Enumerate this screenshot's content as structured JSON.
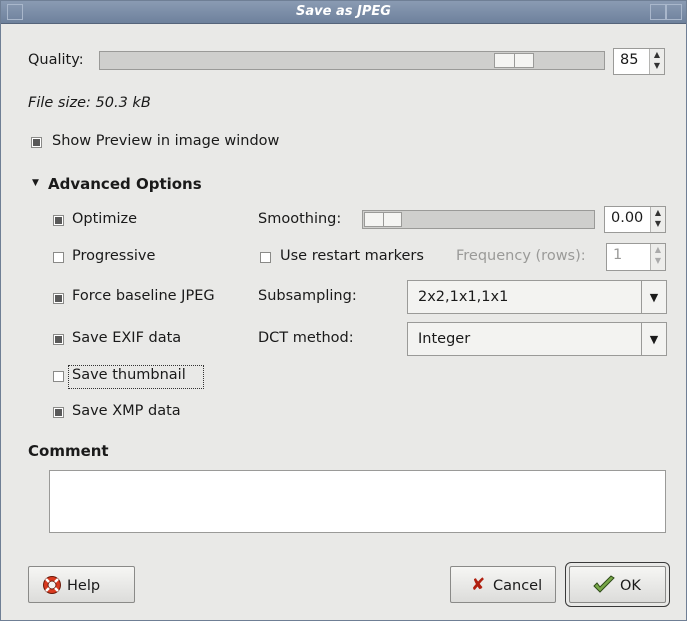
{
  "window": {
    "title": "Save as JPEG"
  },
  "quality": {
    "label": "Quality:",
    "value": "85",
    "fraction": 0.85
  },
  "file_size": {
    "text": "File size: 50.3 kB"
  },
  "show_preview": {
    "label": "Show Preview in image window",
    "checked": true
  },
  "advanced": {
    "header": "Advanced Options",
    "expanded": true,
    "checkboxes": [
      {
        "label": "Optimize",
        "checked": true
      },
      {
        "label": "Progressive",
        "checked": false
      },
      {
        "label": "Force baseline JPEG",
        "checked": true
      },
      {
        "label": "Save EXIF data",
        "checked": true
      },
      {
        "label": "Save thumbnail",
        "checked": false
      },
      {
        "label": "Save XMP data",
        "checked": true
      }
    ],
    "smoothing": {
      "label": "Smoothing:",
      "value": "0.00",
      "fraction": 0.0
    },
    "restart": {
      "label": "Use restart markers",
      "checked": false
    },
    "frequency": {
      "label": "Frequency (rows):",
      "value": "1"
    },
    "subsampling": {
      "label": "Subsampling:",
      "value": "2x2,1x1,1x1"
    },
    "dct": {
      "label": "DCT method:",
      "value": "Integer"
    }
  },
  "comment": {
    "label": "Comment",
    "value": ""
  },
  "buttons": {
    "help": "Help",
    "cancel": "Cancel",
    "ok": "OK"
  }
}
